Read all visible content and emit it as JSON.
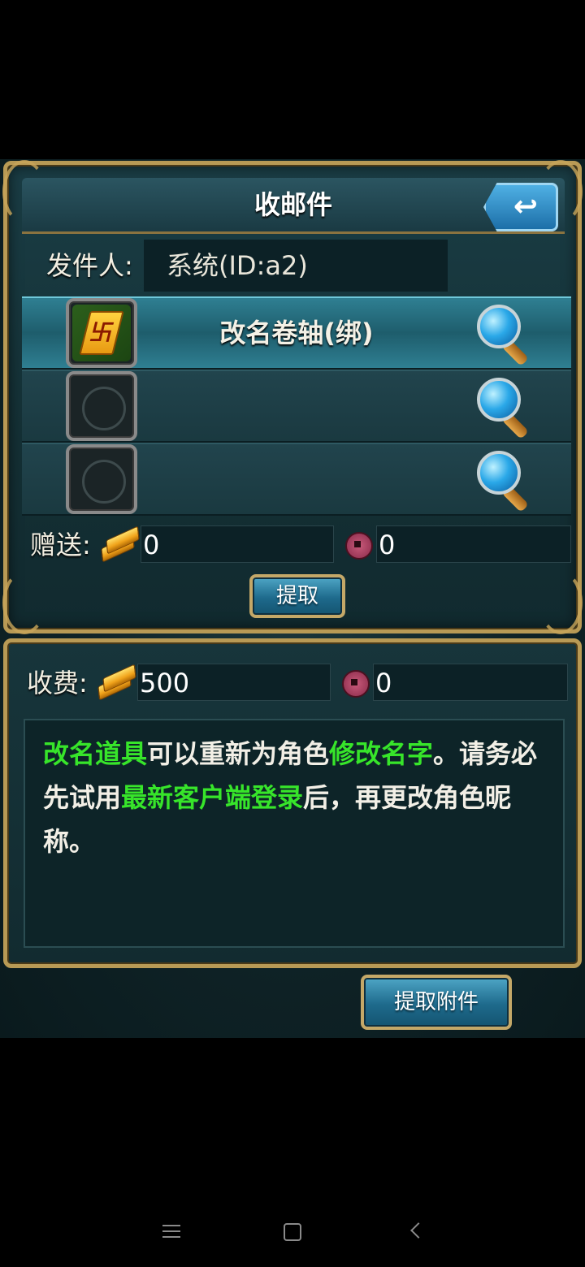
{
  "mail": {
    "title": "收邮件",
    "sender_label": "发件人:",
    "sender_value": "系统(ID:a2)",
    "items": [
      {
        "name": "改名卷轴(绑)",
        "icon": "rename-scroll-icon"
      },
      {
        "name": "",
        "icon": "empty-slot-icon"
      },
      {
        "name": "",
        "icon": "empty-slot-icon"
      }
    ],
    "gift_label": "赠送:",
    "gift_gold": "0",
    "gift_coin": "0",
    "extract_button": "提取"
  },
  "fee": {
    "label": "收费:",
    "gold": "500",
    "coin": "0",
    "description": [
      {
        "text": "改名道具",
        "highlight": true
      },
      {
        "text": "可以重新为角色",
        "highlight": false
      },
      {
        "text": "修改名字",
        "highlight": true
      },
      {
        "text": "。请务必先试用",
        "highlight": false
      },
      {
        "text": "最新客户端登录",
        "highlight": true
      },
      {
        "text": "后，再更改角色昵称。",
        "highlight": false
      }
    ]
  },
  "extract_attachment_button": "提取附件",
  "colors": {
    "highlight_green": "#37e52a",
    "gold_border": "#b89a55",
    "panel_teal": "#1a3d45"
  }
}
